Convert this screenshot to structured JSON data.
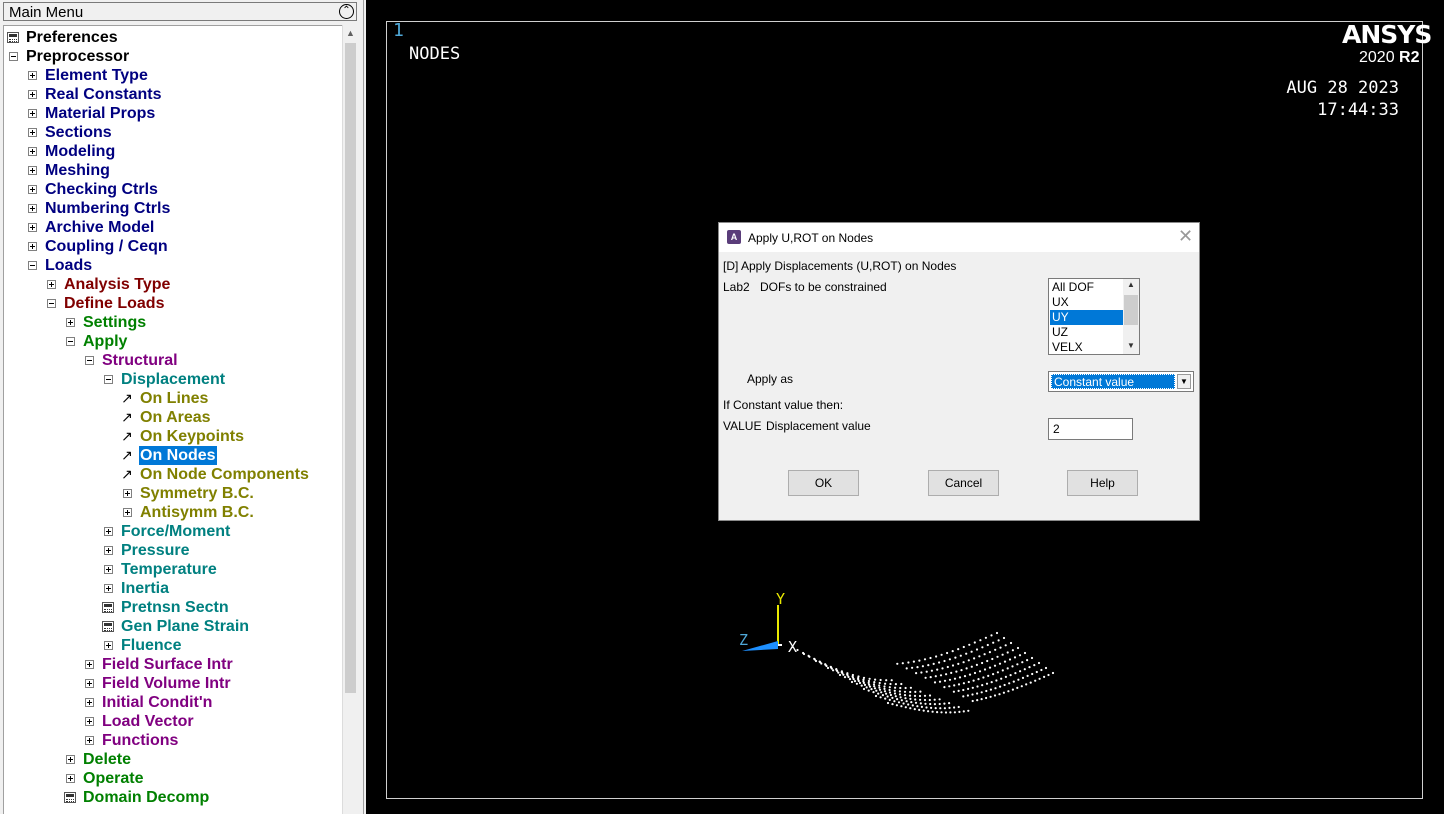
{
  "menu": {
    "title": "Main Menu",
    "items": [
      {
        "label": "Preferences"
      },
      {
        "label": "Preprocessor"
      },
      {
        "label": "Element Type"
      },
      {
        "label": "Real Constants"
      },
      {
        "label": "Material Props"
      },
      {
        "label": "Sections"
      },
      {
        "label": "Modeling"
      },
      {
        "label": "Meshing"
      },
      {
        "label": "Checking Ctrls"
      },
      {
        "label": "Numbering Ctrls"
      },
      {
        "label": "Archive Model"
      },
      {
        "label": "Coupling / Ceqn"
      },
      {
        "label": "Loads"
      },
      {
        "label": "Analysis Type"
      },
      {
        "label": "Define Loads"
      },
      {
        "label": "Settings"
      },
      {
        "label": "Apply"
      },
      {
        "label": "Structural"
      },
      {
        "label": "Displacement"
      },
      {
        "label": "On Lines"
      },
      {
        "label": "On Areas"
      },
      {
        "label": "On Keypoints"
      },
      {
        "label": "On Nodes"
      },
      {
        "label": "On Node Components"
      },
      {
        "label": "Symmetry B.C."
      },
      {
        "label": "Antisymm B.C."
      },
      {
        "label": "Force/Moment"
      },
      {
        "label": "Pressure"
      },
      {
        "label": "Temperature"
      },
      {
        "label": "Inertia"
      },
      {
        "label": "Pretnsn Sectn"
      },
      {
        "label": "Gen Plane Strain"
      },
      {
        "label": "Fluence"
      },
      {
        "label": "Field Surface Intr"
      },
      {
        "label": "Field Volume Intr"
      },
      {
        "label": "Initial Condit'n"
      },
      {
        "label": "Load Vector"
      },
      {
        "label": "Functions"
      },
      {
        "label": "Delete"
      },
      {
        "label": "Operate"
      },
      {
        "label": "Domain Decomp"
      }
    ]
  },
  "graphics": {
    "window_number": "1",
    "plot_label": "NODES",
    "brand": "ANSYS",
    "version": "2020",
    "release": "R2",
    "date": "AUG 28 2023",
    "time": "17:44:33",
    "axes": {
      "x": "X",
      "y": "Y",
      "z": "Z"
    }
  },
  "dialog": {
    "title": "Apply U,ROT on Nodes",
    "heading": "[D]  Apply Displacements (U,ROT) on Nodes",
    "lab2_key": "Lab2",
    "lab2_desc": "DOFs to be constrained",
    "dof_options": [
      "All DOF",
      "UX",
      "UY",
      "UZ",
      "VELX"
    ],
    "dof_selected": "UY",
    "apply_as_label": "Apply as",
    "apply_as_value": "Constant value",
    "if_constant_label": "If Constant value then:",
    "value_key": "VALUE",
    "value_desc": "Displacement value",
    "value": "2",
    "buttons": {
      "ok": "OK",
      "cancel": "Cancel",
      "help": "Help"
    }
  }
}
